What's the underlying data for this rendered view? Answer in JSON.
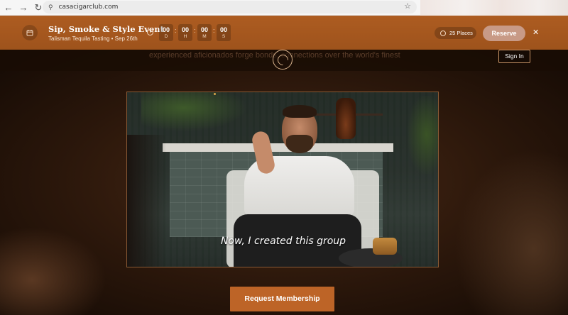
{
  "browser": {
    "url": "casacigarclub.com",
    "back_icon": "arrow-left-icon",
    "forward_icon": "arrow-right-icon",
    "reload_icon": "reload-icon",
    "bookmark_icon": "star-icon"
  },
  "event_banner": {
    "title": "Sip, Smoke & Style Event",
    "subtitle": "Talisman Tequila Tasting • Sep 26th",
    "countdown": [
      {
        "value": "00",
        "unit": "D"
      },
      {
        "value": "00",
        "unit": "H"
      },
      {
        "value": "00",
        "unit": "M"
      },
      {
        "value": "00",
        "unit": "S"
      }
    ],
    "places_label": "25 Places",
    "reserve_label": "Reserve",
    "close_label": "✕",
    "accent_color": "#a7581f"
  },
  "header": {
    "tagline": "experienced aficionados forge bonds. connections over the world's finest",
    "signin_label": "Sign In"
  },
  "video": {
    "caption": "Now, I created this group"
  },
  "cta": {
    "label": "Request Membership",
    "color": "#bd6427"
  }
}
